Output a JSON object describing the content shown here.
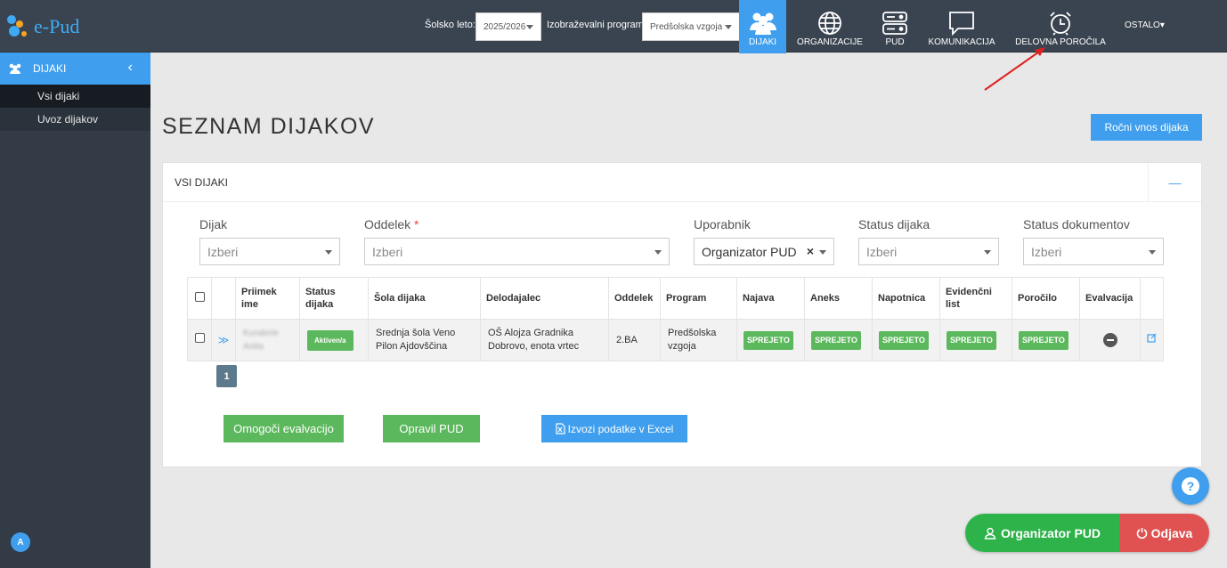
{
  "app": {
    "logo_text": "e-Pud"
  },
  "topbar": {
    "year_label": "Šolsko leto:",
    "year_value": "2025/2026",
    "program_label": "Izobraževalni program:",
    "program_value": "Predšolska vzgoja",
    "nav": [
      {
        "label": "DIJAKI",
        "icon": "users-icon",
        "active": true
      },
      {
        "label": "ORGANIZACIJE",
        "icon": "globe-icon"
      },
      {
        "label": "PUD",
        "icon": "server-icon"
      },
      {
        "label": "KOMUNIKACIJA",
        "icon": "chat-icon"
      },
      {
        "label": "DELOVNA POROČILA",
        "icon": "alarm-clock-icon"
      }
    ],
    "more_label": "OSTALO▾"
  },
  "sidebar": {
    "section": "DIJAKI",
    "items": [
      {
        "label": "Vsi dijaki"
      },
      {
        "label": "Uvoz dijakov"
      }
    ],
    "avatar_letter": "A"
  },
  "main": {
    "title": "SEZNAM DIJAKOV",
    "add_button": "Ročni vnos dijaka",
    "panel_title": "VSI DIJAKI",
    "panel_toggle": "—",
    "filters": {
      "dijak_label": "Dijak",
      "dijak_placeholder": "Izberi",
      "oddelek_label": "Oddelek",
      "oddelek_required": "*",
      "oddelek_placeholder": "Izberi",
      "uporabnik_label": "Uporabnik",
      "uporabnik_value": "Organizator PUD",
      "uporabnik_clear": "×",
      "status_dijaka_label": "Status dijaka",
      "status_dijaka_placeholder": "Izberi",
      "status_dok_label": "Status dokumentov",
      "status_dok_placeholder": "Izberi"
    },
    "table": {
      "headers": {
        "name": "Priimek ime",
        "status": "Status dijaka",
        "school": "Šola dijaka",
        "employer": "Delodajalec",
        "class": "Oddelek",
        "program": "Program",
        "najava": "Najava",
        "aneks": "Aneks",
        "napotnica": "Napotnica",
        "evidencni": "Evidenčni list",
        "porocilo": "Poročilo",
        "evalvacija": "Evalvacija"
      },
      "row": {
        "name": "Kunderle Anita",
        "status": "Aktiven/a",
        "school": "Srednja šola Veno Pilon Ajdovščina",
        "employer": "OŠ Alojza Gradnika Dobrovo, enota vrtec",
        "class": "2.BA",
        "program": "Predšolska vzgoja",
        "najava": "SPREJETO",
        "aneks": "SPREJETO",
        "napotnica": "SPREJETO",
        "evidencni": "SPREJETO",
        "porocilo": "SPREJETO"
      }
    },
    "page": "1",
    "buttons": {
      "evalvacija": "Omogoči evalvacijo",
      "opravil": "Opravil PUD",
      "excel": "Izvozi podatke v Excel"
    }
  },
  "footer": {
    "help": "?",
    "user_role": "Organizator PUD",
    "logout": "Odjava"
  },
  "colors": {
    "accent": "#3f9fee",
    "success": "#5cb85c",
    "danger": "#e05252",
    "topbar": "#3a4450",
    "sidebar": "#323b46"
  }
}
